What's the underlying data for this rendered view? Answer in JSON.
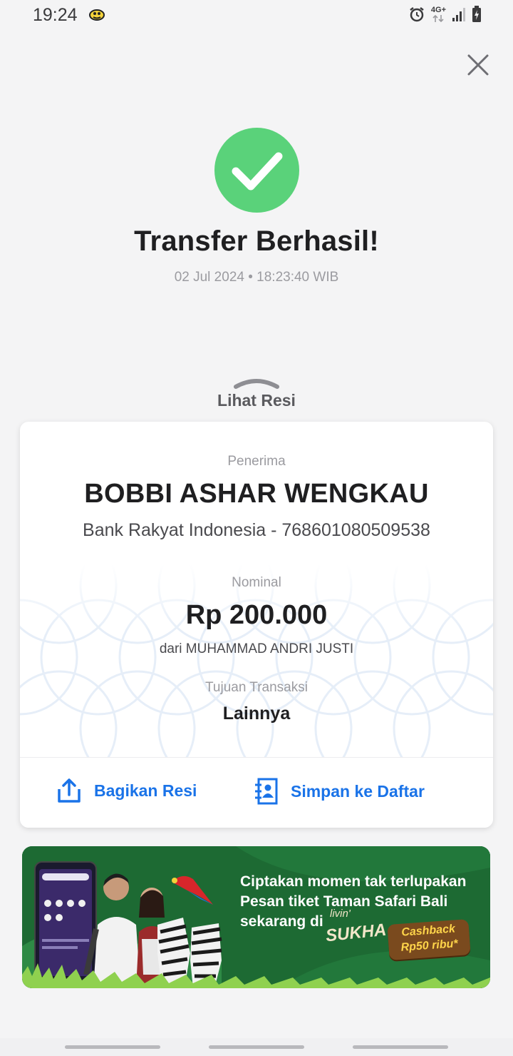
{
  "status_bar": {
    "time": "19:24",
    "network": "4G+"
  },
  "header": {
    "close_icon": "close-icon"
  },
  "result": {
    "title": "Transfer Berhasil!",
    "datetime": "02 Jul 2024 • 18:23:40 WIB",
    "status_color": "#5ad27a"
  },
  "receipt_toggle": {
    "label": "Lihat Resi"
  },
  "receipt": {
    "recipient_label": "Penerima",
    "recipient_name": "BOBBI ASHAR WENGKAU",
    "recipient_bank": "Bank Rakyat Indonesia - 768601080509538",
    "amount_label": "Nominal",
    "amount": "Rp 200.000",
    "sender": "dari MUHAMMAD ANDRI JUSTI",
    "purpose_label": "Tujuan Transaksi",
    "purpose": "Lainnya"
  },
  "actions": {
    "share_label": "Bagikan Resi",
    "save_label": "Simpan ke Daftar",
    "accent_color": "#1a73e8"
  },
  "banner": {
    "line1": "Ciptakan momen tak terlupakan",
    "line2": "Pesan tiket Taman Safari Bali",
    "line3": "sekarang di",
    "brand_small": "livin'",
    "brand": "SUKHA",
    "cashback_line1": "Cashback",
    "cashback_line2": "Rp50 ribu*"
  }
}
